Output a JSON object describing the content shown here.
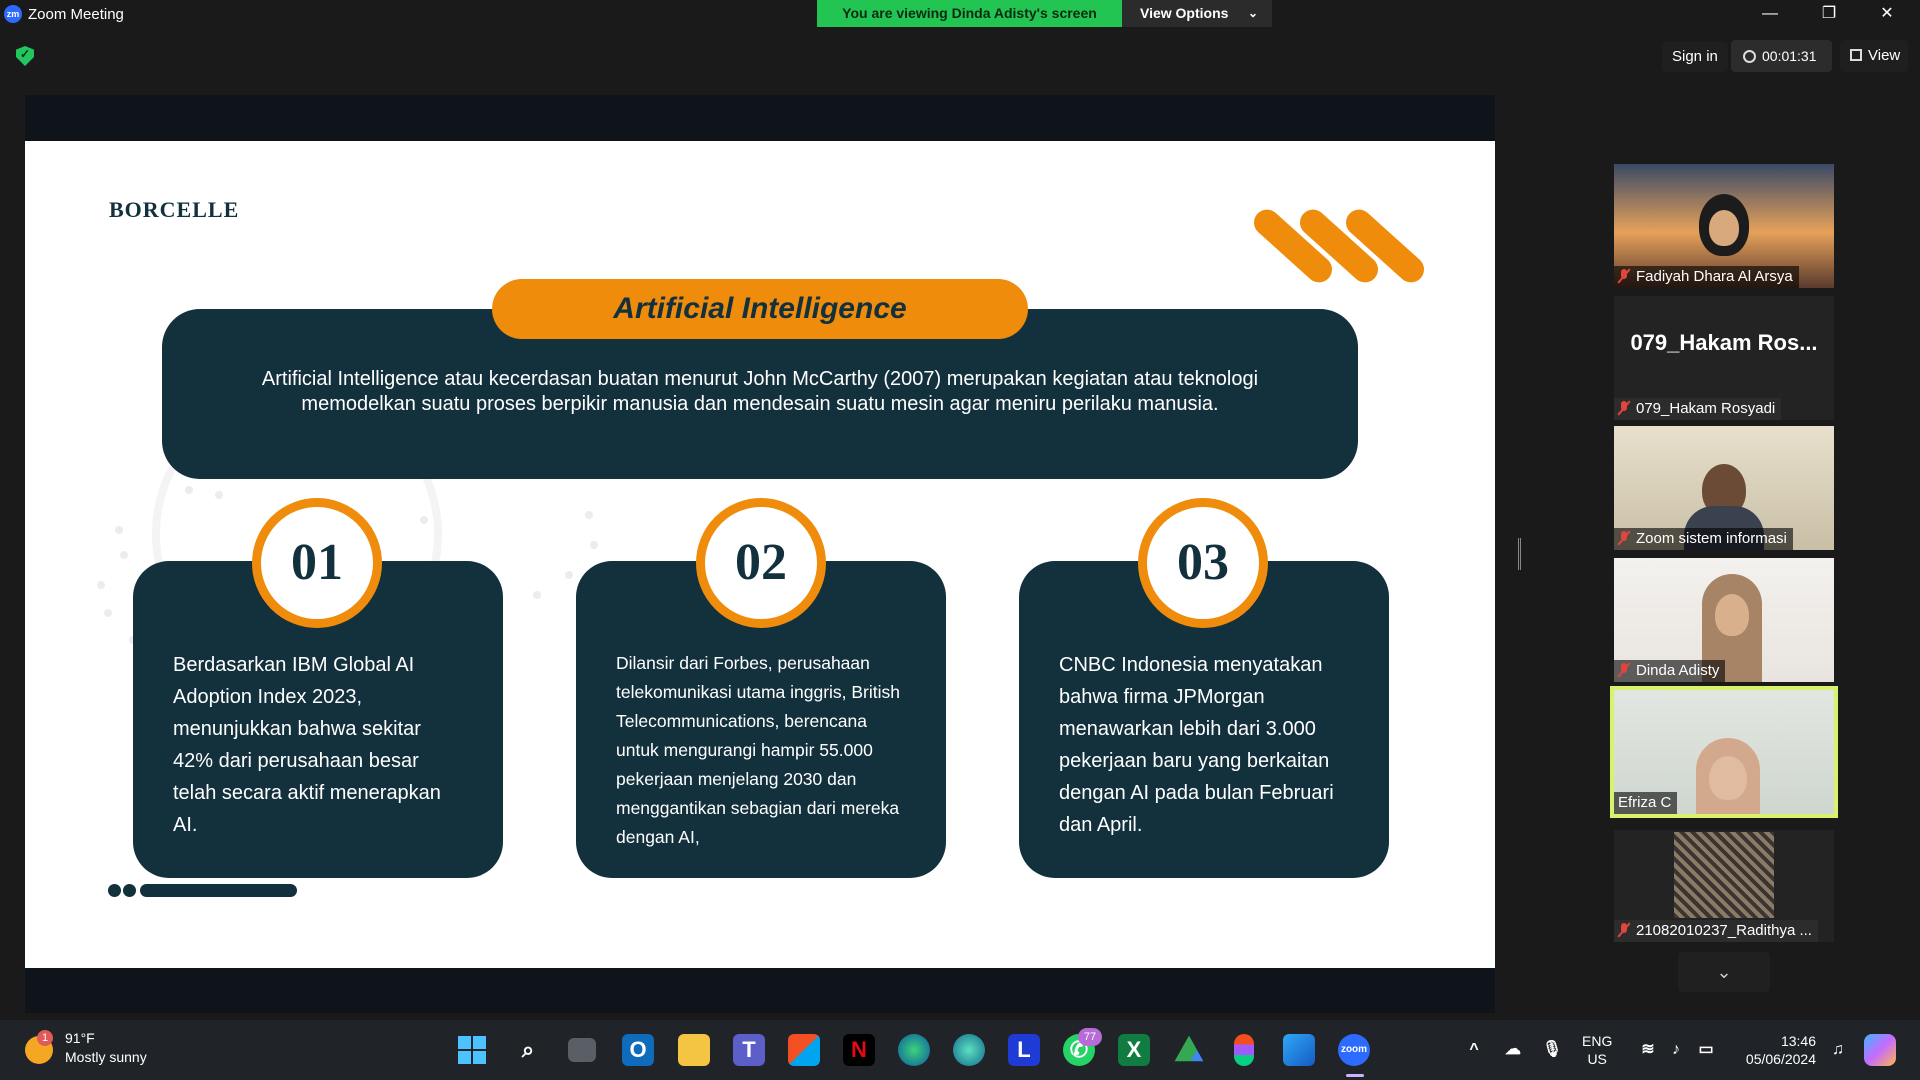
{
  "window": {
    "app_icon": "zm",
    "title": "Zoom Meeting",
    "share_banner": "You are viewing Dinda Adisty's screen",
    "view_options": "View Options",
    "minimize": "—",
    "restore": "❐",
    "close": "✕"
  },
  "toolbar": {
    "sign_in": "Sign in",
    "timer": "00:01:31",
    "view": "View"
  },
  "slide": {
    "brand": "BORCELLE",
    "title": "Artificial Intelligence",
    "definition": "Artificial Intelligence atau kecerdasan buatan menurut John McCarthy (2007) merupakan kegiatan atau teknologi memodelkan suatu proses berpikir manusia dan mendesain suatu mesin agar meniru perilaku manusia.",
    "cards": [
      {
        "number": "01",
        "text": "Berdasarkan IBM Global AI Adoption Index 2023, menunjukkan bahwa sekitar 42% dari perusahaan besar telah secara aktif menerapkan AI."
      },
      {
        "number": "02",
        "text": "Dilansir dari Forbes, perusahaan telekomunikasi utama inggris, British Telecommunications, berencana untuk mengurangi hampir 55.000 pekerjaan menjelang 2030 dan menggantikan sebagian dari mereka dengan AI,"
      },
      {
        "number": "03",
        "text": "CNBC Indonesia menyatakan bahwa firma JPMorgan menawarkan lebih dari 3.000 pekerjaan baru yang berkaitan dengan AI pada bulan Februari dan April."
      }
    ],
    "accent_color": "#f08c0c",
    "dark_color": "#13303d"
  },
  "participants": [
    {
      "name": "Fadiyah Dhara Al Arsya",
      "muted": true
    },
    {
      "name": "079_Hakam Rosyadi",
      "display": "079_Hakam  Ros...",
      "muted": true
    },
    {
      "name": "Zoom sistem informasi",
      "muted": true
    },
    {
      "name": "Dinda Adisty",
      "muted": true
    },
    {
      "name": "Efriza C",
      "muted": false,
      "speaking": true
    },
    {
      "name": "21082010237_Radithya ...",
      "muted": true
    }
  ],
  "panel": {
    "expand_icon": "⌄"
  },
  "taskbar": {
    "weather_temp": "91°F",
    "weather_desc": "Mostly sunny",
    "weather_badge": "1",
    "whatsapp_badge": "77",
    "lang_line1": "ENG",
    "lang_line2": "US",
    "time": "13:46",
    "date": "05/06/2024",
    "apps": [
      "windows-start-icon",
      "search-icon",
      "task-view-icon",
      "outlook-icon",
      "file-explorer-icon",
      "teams-icon",
      "microsoft-store-icon",
      "netflix-icon",
      "edge-icon",
      "edge-dev-icon",
      "l-app-icon",
      "whatsapp-icon",
      "excel-icon",
      "drive-icon",
      "figma-icon",
      "photos-icon",
      "zoom-icon"
    ]
  }
}
